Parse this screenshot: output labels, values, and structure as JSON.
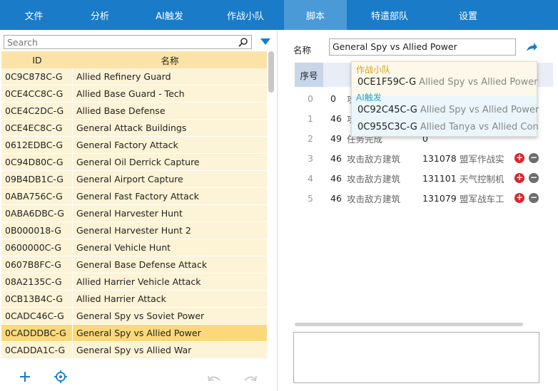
{
  "menu": {
    "items": [
      "文件",
      "分析",
      "AI触发",
      "作战小队",
      "脚本",
      "特遣部队",
      "设置"
    ],
    "active_index": 4
  },
  "left": {
    "search_placeholder": "Search",
    "columns": [
      "ID",
      "名称"
    ],
    "rows": [
      {
        "id": "0C9C878C-G",
        "name": "Allied Refinery Guard"
      },
      {
        "id": "0CE4CC8C-G",
        "name": "Allied Base Guard - Tech"
      },
      {
        "id": "0CE4C2DC-G",
        "name": "Allied Base Defense"
      },
      {
        "id": "0CE4EC8C-G",
        "name": "General Attack Buildings"
      },
      {
        "id": "0612EDBC-G",
        "name": "General Factory Attack"
      },
      {
        "id": "0C94D80C-G",
        "name": "General Oil Derrick Capture"
      },
      {
        "id": "09B4DB1C-G",
        "name": "General Airport Capture"
      },
      {
        "id": "0ABA756C-G",
        "name": "General Fast Factory Attack"
      },
      {
        "id": "0ABA6DBC-G",
        "name": "General Harvester Hunt"
      },
      {
        "id": "0B000018-G",
        "name": "General Harvester Hunt 2"
      },
      {
        "id": "0600000C-G",
        "name": "General Vehicle Hunt"
      },
      {
        "id": "0607B8FC-G",
        "name": "General Base Defense Attack"
      },
      {
        "id": "08A2135C-G",
        "name": "Allied Harrier Vehicle Attack"
      },
      {
        "id": "0CB13B4C-G",
        "name": "Allied Harrier Attack"
      },
      {
        "id": "0CADC46C-G",
        "name": "General Spy vs Soviet Power"
      },
      {
        "id": "0CADDDBC-G",
        "name": "General Spy vs Allied Power"
      },
      {
        "id": "0CADDA1C-G",
        "name": "General Spy vs Allied War"
      }
    ],
    "selected_index": 15
  },
  "right": {
    "name_label": "名称",
    "name_value": "General Spy vs Allied Power",
    "seq_header": "序号",
    "rows": [
      {
        "seq": "0",
        "code": "0",
        "action": "攻",
        "value": "",
        "desc": ""
      },
      {
        "seq": "1",
        "code": "46",
        "action": "攻",
        "value": "",
        "desc": ""
      },
      {
        "seq": "2",
        "code": "49",
        "action": "任务完成",
        "value": "0",
        "desc": ""
      },
      {
        "seq": "3",
        "code": "46",
        "action": "攻击敌方建筑",
        "value": "131078",
        "desc": "盟军作战实"
      },
      {
        "seq": "4",
        "code": "46",
        "action": "攻击敌方建筑",
        "value": "131101",
        "desc": "天气控制机"
      },
      {
        "seq": "5",
        "code": "46",
        "action": "攻击敌方建筑",
        "value": "131079",
        "desc": "盟军战车工"
      }
    ]
  },
  "dropdown": {
    "groups": [
      {
        "title": "作战小队",
        "title_color": "#d4a017",
        "items": [
          {
            "id": "0CE1F59C-G",
            "name": "Allied Spy vs Allied Power"
          }
        ]
      },
      {
        "title": "AI触发",
        "title_color": "#2aa3c9",
        "items": [
          {
            "id": "0C92C45C-G",
            "name": "Allied Spy vs Allied Power"
          },
          {
            "id": "0C955C3C-G",
            "name": "Allied Tanya vs Allied Con"
          }
        ]
      }
    ]
  },
  "colors": {
    "menubar": "#1a7bc9",
    "menu_active": "#4a9ad8",
    "row_bg": "#fdf3d6",
    "row_selected": "#fbd97a",
    "header_bg": "#fbe3a8"
  }
}
